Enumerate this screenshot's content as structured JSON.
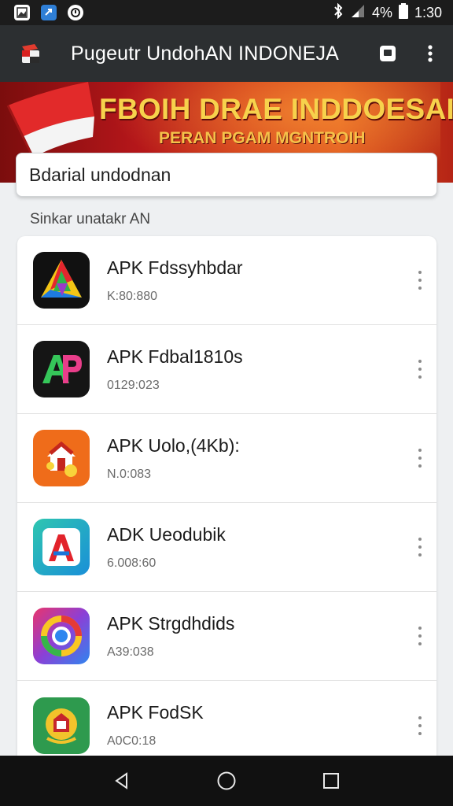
{
  "status_bar": {
    "battery_text": "4%",
    "time": "1:30",
    "icons": [
      "gallery-icon",
      "message-icon",
      "app-notification-icon",
      "bluetooth-icon",
      "signal-icon",
      "battery-icon"
    ]
  },
  "app_bar": {
    "title": "Pugeutr UndohAN INDONEJA",
    "actions": [
      "square-icon",
      "more-vert-icon"
    ]
  },
  "banner": {
    "title": "FBOIH DRAE INDDOESAII",
    "subtitle": "PERAN PGAM MGNTROIH"
  },
  "search": {
    "placeholder": "Bdarial undodnan"
  },
  "section": {
    "label": "Sinkar unatakr AN"
  },
  "apps": [
    {
      "name": "APK Fdssyhbdar",
      "size": "K:80:880",
      "icon": "triangle-logo-icon"
    },
    {
      "name": "APK Fdbal1810s",
      "size": "0129:023",
      "icon": "ap-logo-icon"
    },
    {
      "name": "APK Uolo,(4Kb):",
      "size": "N.0:083",
      "icon": "house-logo-icon"
    },
    {
      "name": "ADK Ueodubik",
      "size": "6.008:60",
      "icon": "a-logo-icon"
    },
    {
      "name": "APK Strgdhdids",
      "size": "A39:038",
      "icon": "circle-logo-icon"
    },
    {
      "name": "APK FodSK",
      "size": "A0C0:18",
      "icon": "emblem-logo-icon"
    }
  ],
  "colors": {
    "status_bar": "#1c1c1c",
    "app_bar": "#2c2f31",
    "banner_red": "#b4161a",
    "banner_text": "#f7d24c"
  }
}
